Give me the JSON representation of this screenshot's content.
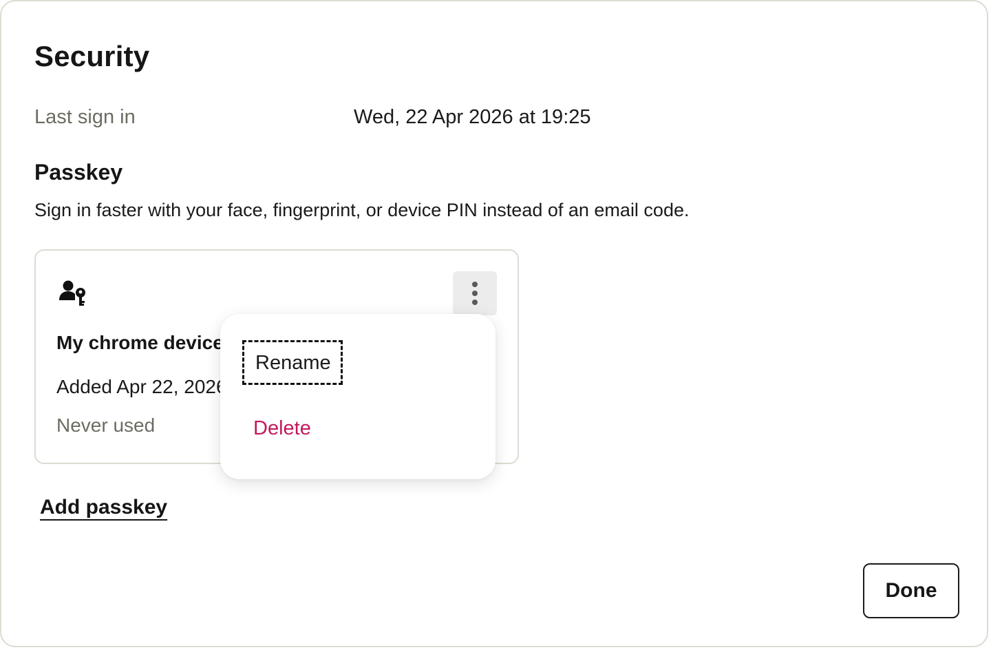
{
  "dialog": {
    "title": "Security",
    "last_sign_in": {
      "label": "Last sign in",
      "value": "Wed, 22 Apr 2026 at 19:25"
    },
    "passkey_section": {
      "title": "Passkey",
      "description": "Sign in faster with your face, fingerprint, or device PIN instead of an email code."
    },
    "passkey_card": {
      "icon": "user-key-icon",
      "name": "My chrome device",
      "added": "Added Apr 22, 2026",
      "usage": "Never used",
      "menu_icon": "more-vertical-icon"
    },
    "context_menu": {
      "items": [
        {
          "label": "Rename",
          "color": "#1a1a1a"
        },
        {
          "label": "Delete",
          "color": "#c2185b"
        }
      ]
    },
    "add_passkey_label": "Add passkey",
    "done_label": "Done"
  }
}
